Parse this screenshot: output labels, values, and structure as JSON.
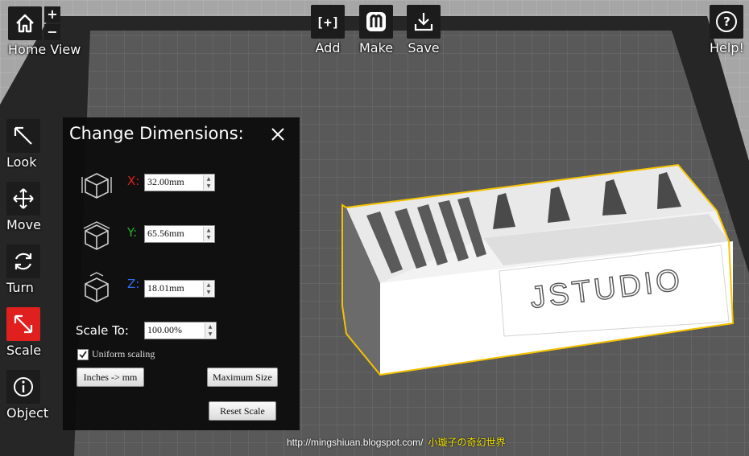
{
  "top_toolbar": {
    "home_view_label": "Home View",
    "zoom_in": "+",
    "zoom_out": "−",
    "add_icon_text": "[+]",
    "add_label": "Add",
    "make_label": "Make",
    "save_label": "Save",
    "help_icon_text": "?",
    "help_label": "Help!"
  },
  "left_toolbar": {
    "look_label": "Look",
    "move_label": "Move",
    "turn_label": "Turn",
    "scale_label": "Scale",
    "object_label": "Object",
    "active_tool": "Scale"
  },
  "dialog": {
    "title": "Change Dimensions:",
    "x_label": "X:",
    "x_value": "32.00mm",
    "y_label": "Y:",
    "y_value": "65.56mm",
    "z_label": "Z:",
    "z_value": "18.01mm",
    "scale_label": "Scale To:",
    "scale_value": "100.00%",
    "uniform_label": "Uniform scaling",
    "uniform_checked": true,
    "inches_button": "Inches -> mm",
    "max_button": "Maximum Size",
    "reset_button": "Reset Scale"
  },
  "model": {
    "engraved_text": "JSTUDIO"
  },
  "watermark": {
    "url": "http://mingshiuan.blogspot.com/",
    "blog_name": "小璇子の奇幻世界"
  },
  "colors": {
    "x_axis": "#e02020",
    "y_axis": "#27b227",
    "z_axis": "#2a6cf0",
    "active_tool": "#e0201f",
    "selection": "#f5c200"
  }
}
